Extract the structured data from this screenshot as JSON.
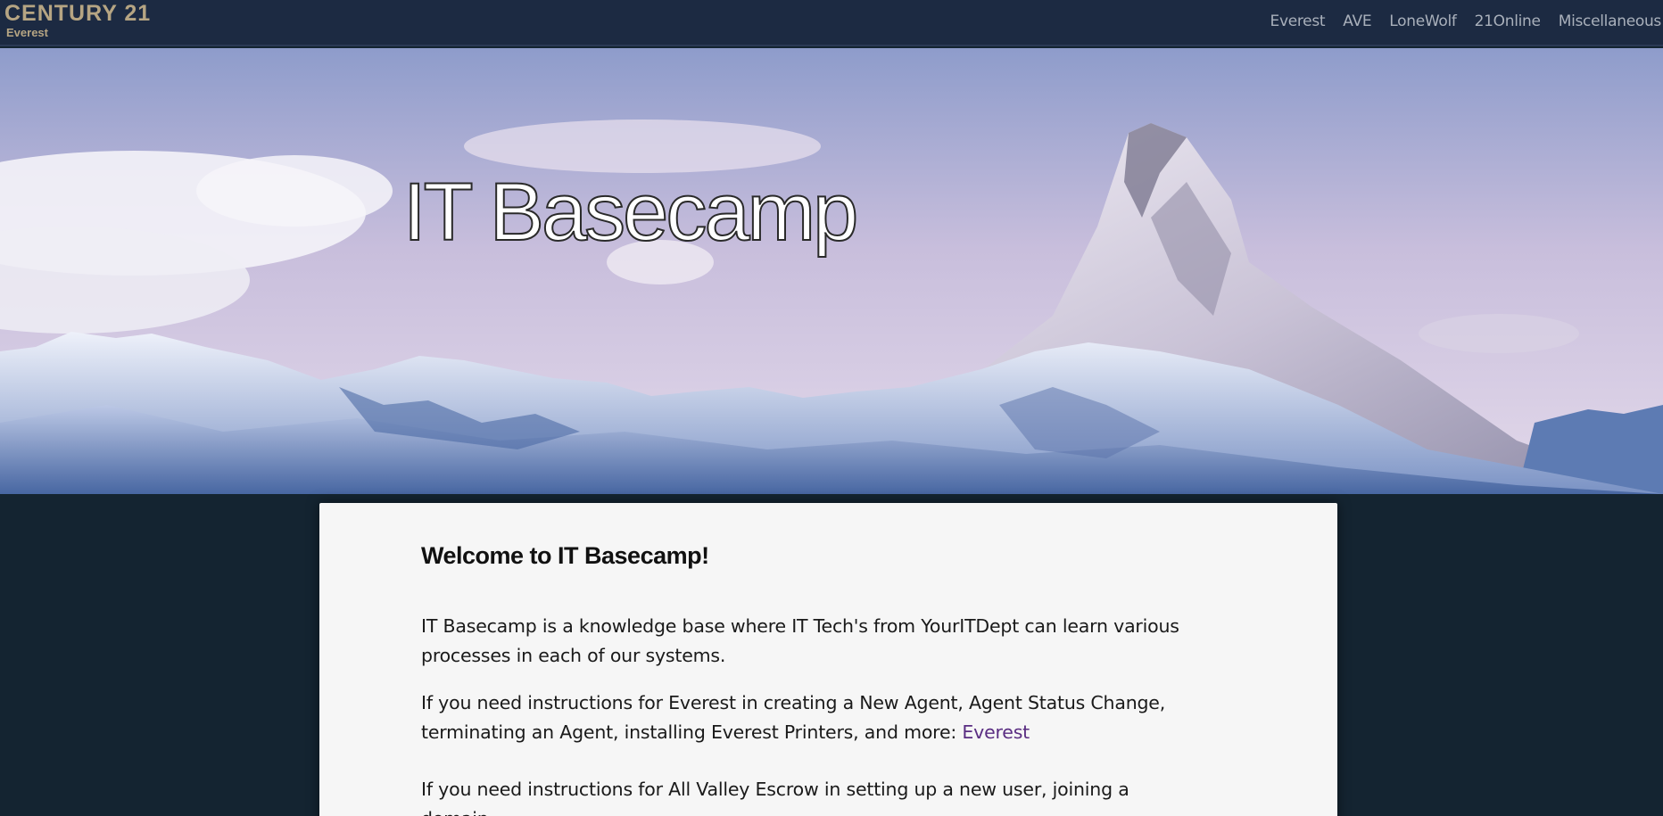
{
  "header": {
    "logo_main": "CENTURY 21",
    "logo_sub": "Everest",
    "nav": [
      "Everest",
      "AVE",
      "LoneWolf",
      "21Online",
      "Miscellaneous"
    ]
  },
  "hero": {
    "title": "IT Basecamp"
  },
  "content": {
    "welcome": "Welcome to IT Basecamp!",
    "para1": "IT Basecamp is a knowledge base where IT Tech's from YourITDept can learn various processes in each of our systems.",
    "para2_text": "If you need instructions for Everest in creating a New Agent, Agent Status Change, terminating an Agent, installing Everest Printers, and more: ",
    "para2_link": "Everest",
    "para3_text": "If you need instructions for All Valley Escrow in setting up a new user, joining a domain,"
  },
  "colors": {
    "header_bg": "#1c2a42",
    "page_bg": "#142431",
    "logo_gold": "#b6a583",
    "link_purple": "#5a2d82",
    "card_bg": "#f6f6f6"
  }
}
